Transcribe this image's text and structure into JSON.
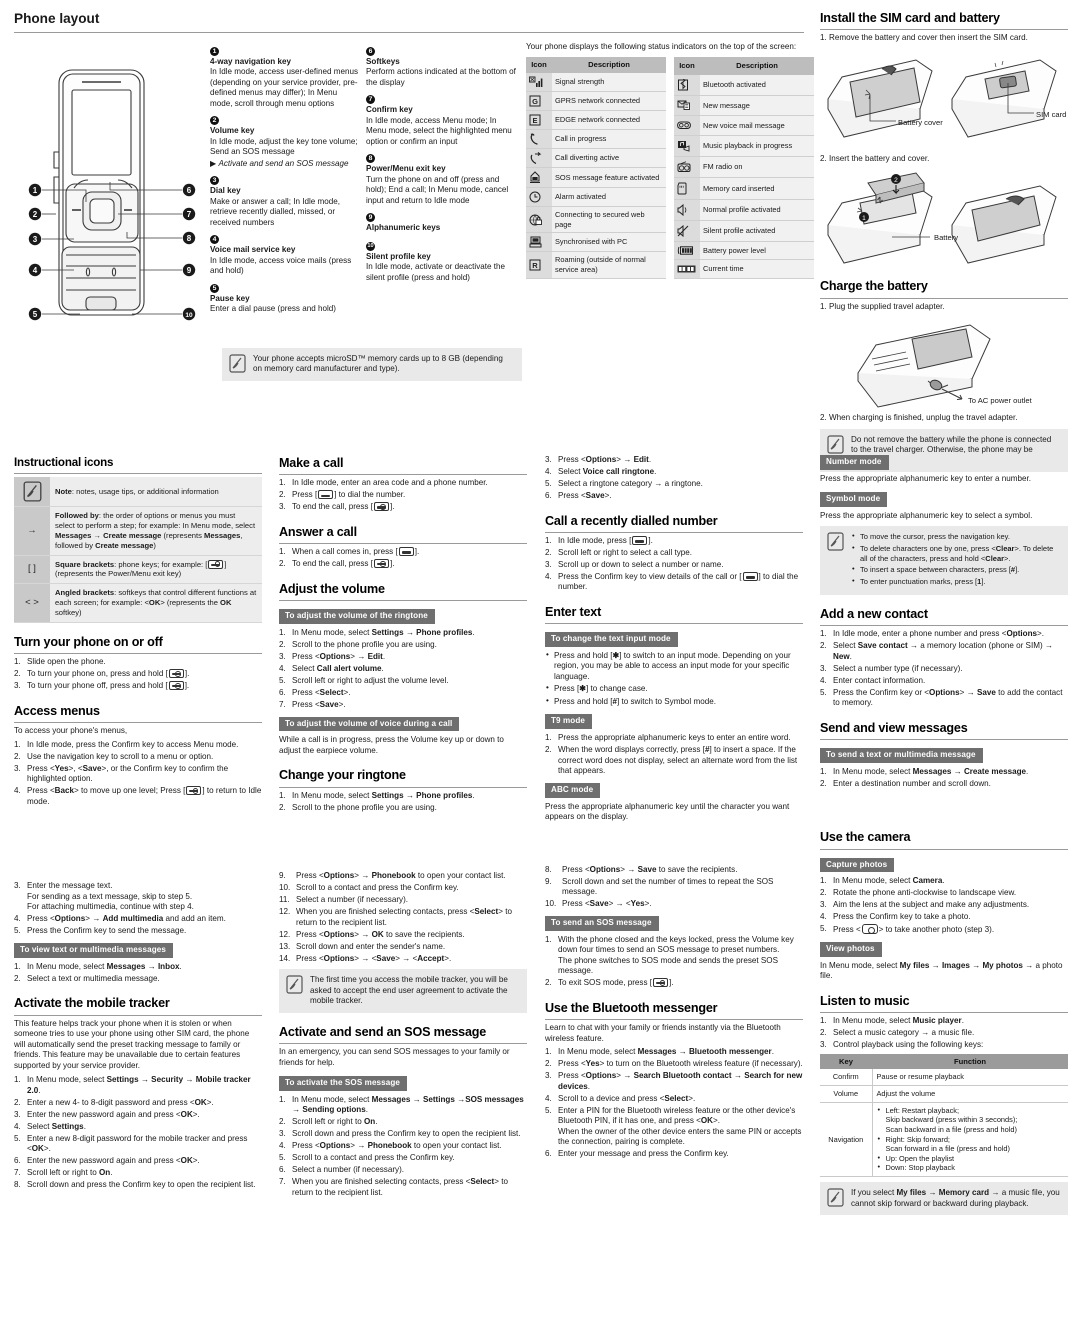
{
  "phone_layout": {
    "title": "Phone layout",
    "keys": [
      {
        "n": "1",
        "title": "4-way navigation key",
        "desc": "In Idle mode, access user-defined menus (depending on your service provider, pre-defined menus may differ); In Menu mode, scroll through menu options"
      },
      {
        "n": "2",
        "title": "Volume key",
        "desc": "In Idle mode, adjust the key tone volume; Send an SOS message",
        "ref": "Activate and send an SOS message"
      },
      {
        "n": "3",
        "title": "Dial key",
        "desc": "Make or answer a call; In Idle mode, retrieve recently dialled, missed, or received numbers"
      },
      {
        "n": "4",
        "title": "Voice mail service key",
        "desc": "In Idle mode, access voice mails (press and hold)"
      },
      {
        "n": "5",
        "title": "Pause key",
        "desc": "Enter a dial pause (press and hold)"
      },
      {
        "n": "6",
        "title": "Softkeys",
        "desc": "Perform actions indicated at the bottom of the display"
      },
      {
        "n": "7",
        "title": "Confirm key",
        "desc": "In Idle mode, access Menu mode; In Menu mode, select the highlighted menu option or confirm an input"
      },
      {
        "n": "8",
        "title": "Power/Menu exit key",
        "desc": "Turn the phone on and off (press and hold); End a call; In Menu mode, cancel input and return to Idle mode"
      },
      {
        "n": "9",
        "title": "Alphanumeric keys",
        "desc": ""
      },
      {
        "n": "10",
        "title": "Silent profile key",
        "desc": "In Idle mode, activate or deactivate the silent profile (press and hold)"
      }
    ],
    "callouts": [
      "1",
      "2",
      "3",
      "4",
      "5",
      "6",
      "7",
      "8",
      "9",
      "10"
    ],
    "microsd_note": "Your phone accepts microSD™ memory cards up to 8 GB (depending on memory card manufacturer and type)."
  },
  "status_indicators": {
    "intro": "Your phone displays the following status indicators on the top of the screen:",
    "header_icon": "Icon",
    "header_desc": "Description",
    "left": [
      {
        "icon": "signal-strength-icon",
        "glyph": "ᴻ",
        "desc": "Signal strength"
      },
      {
        "icon": "gprs-icon",
        "glyph": "G",
        "desc": "GPRS network connected"
      },
      {
        "icon": "edge-icon",
        "glyph": "E",
        "desc": "EDGE network connected"
      },
      {
        "icon": "call-in-progress-icon",
        "glyph": "✆",
        "desc": "Call in progress"
      },
      {
        "icon": "call-diverting-icon",
        "glyph": "↪",
        "desc": "Call diverting active"
      },
      {
        "icon": "sos-message-icon",
        "glyph": "⚠",
        "desc": "SOS message feature activated"
      },
      {
        "icon": "alarm-icon",
        "glyph": "◴",
        "desc": "Alarm activated"
      },
      {
        "icon": "secure-web-icon",
        "glyph": "ὑ2",
        "desc": "Connecting to secured web page"
      },
      {
        "icon": "sync-pc-icon",
        "glyph": "⌸",
        "desc": "Synchronised with PC"
      },
      {
        "icon": "roaming-icon",
        "glyph": "R",
        "desc": "Roaming (outside of normal service area)"
      }
    ],
    "right": [
      {
        "icon": "bluetooth-icon",
        "glyph": "ᛦ",
        "desc": "Bluetooth activated"
      },
      {
        "icon": "new-message-icon",
        "glyph": "✉",
        "desc": "New message"
      },
      {
        "icon": "new-voicemail-icon",
        "glyph": "∞",
        "desc": "New voice mail message"
      },
      {
        "icon": "music-playback-icon",
        "glyph": "♪",
        "desc": "Music playback in progress"
      },
      {
        "icon": "fm-radio-icon",
        "glyph": "◎",
        "desc": "FM radio on"
      },
      {
        "icon": "memory-card-icon",
        "glyph": "▭",
        "desc": "Memory card inserted"
      },
      {
        "icon": "normal-profile-icon",
        "glyph": "◁",
        "desc": "Normal profile activated"
      },
      {
        "icon": "silent-profile-icon",
        "glyph": "◁",
        "desc": "Silent profile activated"
      },
      {
        "icon": "battery-icon",
        "glyph": "▐",
        "desc": "Battery power level"
      },
      {
        "icon": "current-time-icon",
        "glyph": "⏱",
        "desc": "Current time"
      }
    ]
  },
  "sim_battery": {
    "title": "Install the SIM card and battery",
    "step1": "1. Remove the battery and cover then insert the SIM card.",
    "label_battery_cover": "Battery cover",
    "label_sim_card": "SIM card",
    "step2": "2. Insert the battery and cover.",
    "label_battery": "Battery",
    "marker1": "1",
    "marker2": "2"
  },
  "charge_battery": {
    "title": "Charge the battery",
    "step1": "1. Plug the supplied travel adapter.",
    "label_ac": "To AC power outlet",
    "step2": "2. When charging is finished, unplug the travel adapter.",
    "note": "Do not remove the battery while the phone is connected to the travel charger. Otherwise, the phone may be damaged."
  },
  "instructional_icons": {
    "title": "Instructional icons",
    "rows": [
      {
        "sym": "note-icon",
        "desc_prefix": "Note",
        "desc": ": notes, usage tips, or additional information"
      },
      {
        "sym": "→",
        "desc_prefix": "Followed by",
        "desc": ": the order of options or menus you must select to perform a step; for example: In Menu mode, select Messages → Create message (represents Messages, followed by Create message)"
      },
      {
        "sym": "[  ]",
        "desc_prefix": "Square brackets",
        "desc": ": phone keys; for example: [KEY] (represents the Power/Menu exit key)"
      },
      {
        "sym": "<  >",
        "desc_prefix": "Angled brackets",
        "desc": ": softkeys that control different functions at each screen; for example: <OK> (represents the OK softkey)"
      }
    ]
  },
  "turn_on_off": {
    "title": "Turn your phone on or off",
    "steps": [
      "Slide open the phone.",
      "To turn your phone on, press and hold [KEY].",
      "To turn your phone off, press and hold [KEY]."
    ]
  },
  "access_menus": {
    "title": "Access menus",
    "intro": "To access your phone's menus,",
    "steps": [
      "In Idle mode, press the Confirm key to access Menu mode.",
      "Use the navigation key to scroll to a menu or option.",
      "Press <Yes>, <Save>, or the Confirm key to confirm the highlighted option.",
      "Press <Back> to move up one level; Press [KEY] to return to Idle mode."
    ]
  },
  "send_message_cont": {
    "steps": [
      "Enter the message text. For sending as a text message, skip to step 5. For attaching multimedia, continue with step 4.",
      "Press <Options> → Add multimedia and add an item.",
      "Press the Confirm key to send the message."
    ],
    "subbar": "To view text or multimedia messages",
    "view_steps": [
      "In Menu mode, select Messages → Inbox.",
      "Select a text or multimedia message."
    ]
  },
  "mobile_tracker": {
    "title": "Activate the mobile tracker",
    "intro": "This feature helps track your phone when it is stolen or when someone tries to use your phone using other SIM card, the phone will automatically send the preset tracking message to family or friends. This feature may be unavailable due to certain features supported by your service provider.",
    "steps": [
      "In Menu mode, select Settings → Security → Mobile tracker 2.0.",
      "Enter a new 4- to 8-digit password and press <OK>.",
      "Enter the new password again and press <OK>.",
      "Select Settings.",
      "Enter a new 8-digit password for the mobile tracker and press <OK>.",
      "Enter the new password again and press <OK>.",
      "Scroll left or right to On.",
      "Scroll down and press the Confirm key to open the recipient list."
    ]
  },
  "make_call": {
    "title": "Make a call",
    "steps": [
      "In Idle mode, enter an area code and a phone number.",
      "Press [DIAL] to dial the number.",
      "To end the call, press [KEY]."
    ]
  },
  "answer_call": {
    "title": "Answer a call",
    "steps": [
      "When a call comes in, press [DIAL].",
      "To end the call, press [KEY]."
    ]
  },
  "adjust_volume": {
    "title": "Adjust the volume",
    "subbar1": "To adjust the volume of the ringtone",
    "steps": [
      "In Menu mode, select Settings → Phone profiles.",
      "Scroll to the phone profile you are using.",
      "Press <Options> → Edit.",
      "Select Call alert volume.",
      "Scroll left or right to adjust the volume level.",
      "Press <Select>.",
      "Press <Save>."
    ],
    "subbar2": "To adjust the volume of voice during a call",
    "body2": "While a call is in progress, press the Volume key up or down to adjust the earpiece volume."
  },
  "change_ringtone": {
    "title": "Change your ringtone",
    "steps": [
      "In Menu mode, select Settings → Phone profiles.",
      "Scroll to the phone profile you are using.",
      "Press <Options> → Edit.",
      "Select Voice call ringtone.",
      "Select a ringtone category → a ringtone.",
      "Press <Save>."
    ]
  },
  "sos_cont_col2": {
    "steps": [
      "Press <Options> → Phonebook to open your contact list.",
      "Scroll to a contact and press the Confirm key.",
      "Select a number (if necessary).",
      "When you are finished selecting contacts, press <Select> to return to the recipient list.",
      "Press <Options> → OK to save the recipients.",
      "Scroll down and enter the sender's name.",
      "Press <Options> → <Save> → <Accept>."
    ],
    "numbers": [
      "9.",
      "10.",
      "11.",
      "12.",
      "12.",
      "13.",
      "14."
    ],
    "note": "The first time you access the mobile tracker, you will be asked to accept the end user agreement to activate the mobile tracker."
  },
  "sos_message": {
    "title": "Activate and send an SOS message",
    "intro": "In an emergency, you can send SOS messages to your family or friends for help.",
    "subbar": "To activate the SOS message",
    "steps": [
      "In Menu mode, select Messages → Settings →SOS messages → Sending options.",
      "Scroll left or right to On.",
      "Scroll down and press the Confirm key to open the recipient list.",
      "Press <Options> → Phonebook to open your contact list.",
      "Scroll to a contact and press the Confirm key.",
      "Select a number (if necessary).",
      "When you are finished selecting contacts, press <Select> to return to the recipient list."
    ]
  },
  "recent_call": {
    "title": "Call a recently dialled number",
    "steps": [
      "In Idle mode, press [DIAL].",
      "Scroll left or right to select a call type.",
      "Scroll up or down to select a number or name.",
      "Press the Confirm key to view details of the call or [DIAL] to dial the number."
    ]
  },
  "enter_text": {
    "title": "Enter text",
    "subbar_change": "To change the text input mode",
    "bullets": [
      "Press and hold [*] to switch to an input mode. Depending on your region, you may be able to access an input mode for your specific language.",
      "Press [*] to change case.",
      "Press and hold [#] to switch to Symbol mode."
    ],
    "subbar_t9": "T9 mode",
    "t9_steps": [
      "Press the appropriate alphanumeric keys to enter an entire word.",
      "When the word displays correctly, press [#] to insert a space. If the correct word does not display, select an alternate word from the list that appears."
    ],
    "subbar_abc": "ABC mode",
    "abc_body": "Press the appropriate alphanumeric key until the character you want appears on the display.",
    "subbar_number": "Number mode",
    "number_body": "Press the appropriate alphanumeric key to enter a number.",
    "subbar_symbol": "Symbol mode",
    "symbol_body": "Press the appropriate alphanumeric key to select a symbol.",
    "note_bullets": [
      "To move the cursor, press the navigation key.",
      "To delete characters one by one, press <Clear>. To delete all of the characters, press and hold <Clear>.",
      "To insert a space between characters, press [#].",
      "To enter punctuation marks, press [1]."
    ]
  },
  "sos_cont_col3": {
    "steps": [
      "Press <Options> → Save to save the recipients.",
      "Scroll down and set the number of times to repeat the SOS message.",
      "Press <Save> → <Yes>."
    ],
    "numbers": [
      "8.",
      "9.",
      "10."
    ],
    "subbar_send": "To send an SOS message",
    "send_steps": [
      "With the phone closed and the keys locked, press the Volume key down four times to send an SOS message to preset numbers. The phone switches to SOS mode and sends the preset SOS message.",
      "To exit SOS mode, press [KEY]."
    ]
  },
  "bluetooth_messenger": {
    "title": "Use the Bluetooth messenger",
    "intro": "Learn to chat with your family or friends instantly via the Bluetooth wireless feature.",
    "steps": [
      "In Menu mode, select Messages → Bluetooth messenger.",
      "Press <Yes> to turn on the Bluetooth wireless feature (if necessary).",
      "Press <Options> → Search Bluetooth contact → Search for new devices.",
      "Scroll to a device and press <Select>.",
      "Enter a PIN for the Bluetooth wireless feature or the other device's Bluetooth PIN, if it has one, and press <OK>. When the owner of the other device enters the same PIN or accepts the connection, pairing is complete.",
      "Enter your message and press the Confirm key."
    ]
  },
  "add_contact": {
    "title": "Add a new contact",
    "steps": [
      "In Idle mode, enter a phone number and press <Options>.",
      "Select Save contact → a memory location (phone or SIM) → New.",
      "Select a number type (if necessary).",
      "Enter contact information.",
      "Press the Confirm key or <Options> → Save to add the contact to memory."
    ]
  },
  "send_view_messages": {
    "title": "Send and view messages",
    "subbar": "To send a text or multimedia message",
    "steps": [
      "In Menu mode, select Messages → Create message.",
      "Enter a destination number and scroll down."
    ]
  },
  "use_camera": {
    "title": "Use the camera",
    "subbar_capture": "Capture photos",
    "capture_steps": [
      "In Menu mode, select Camera.",
      "Rotate the phone anti-clockwise to landscape view.",
      "Aim the lens at the subject and make any adjustments.",
      "Press the Confirm key to take a photo.",
      "Press <CAM> to take another photo (step 3)."
    ],
    "subbar_view": "View photos",
    "view_body": "In Menu mode, select My files → Images → My photos → a photo file."
  },
  "listen_music": {
    "title": "Listen to music",
    "steps": [
      "In Menu mode, select Music player.",
      "Select a music category → a music file.",
      "Control playback using the following keys:"
    ],
    "table": {
      "header_key": "Key",
      "header_function": "Function",
      "rows": [
        {
          "key": "Confirm",
          "fn": "Pause or resume playback"
        },
        {
          "key": "Volume",
          "fn": "Adjust the volume"
        },
        {
          "key": "Navigation",
          "fn_bullets": [
            "Left: Restart playback; Skip backward (press within 3 seconds); Scan backward in a file (press and hold)",
            "Right: Skip forward; Scan forward in a file (press and hold)",
            "Up: Open the playlist",
            "Down: Stop playback"
          ]
        }
      ]
    },
    "note": "If you select My files → Memory card → a music file, you cannot skip forward or backward during playback."
  },
  "colors": {
    "rule": "#9a9a9a",
    "subbar_bg": "#6f6f6f",
    "note_bg": "#e9e9e9",
    "table_header": "#bdbdbd",
    "icon_cell": "#dcdcdc"
  }
}
